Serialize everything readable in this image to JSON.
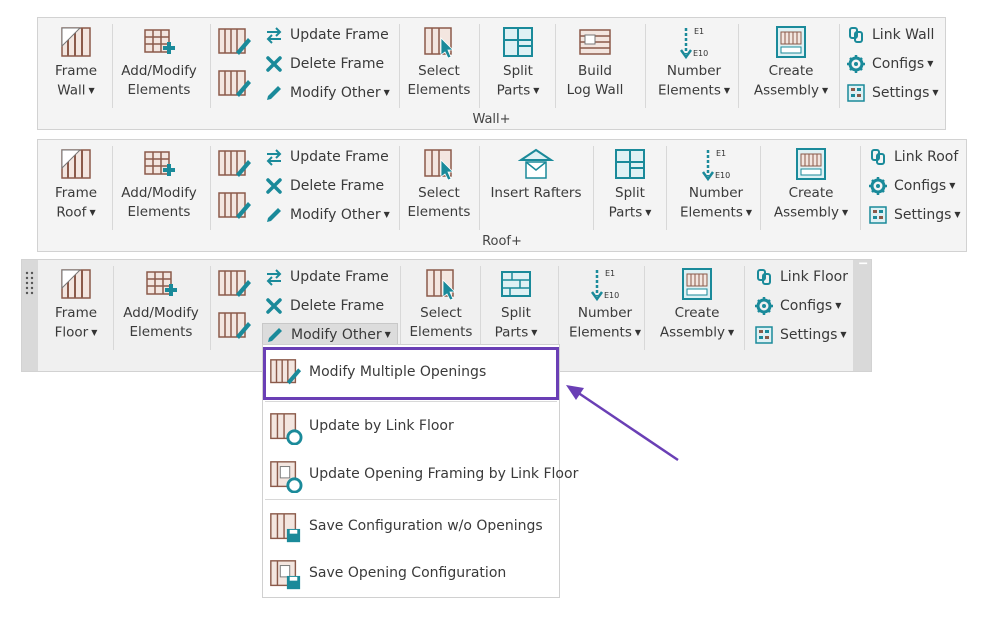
{
  "wall": {
    "title": "Wall+",
    "frame": "Frame\nWall",
    "add_modify": "Add/Modify\nElements",
    "update_frame": "Update Frame",
    "delete_frame": "Delete Frame",
    "modify_other": "Modify Other",
    "select": "Select\nElements",
    "split": "Split\nParts",
    "build_log": "Build\nLog Wall",
    "number": "Number\nElements",
    "create_assembly": "Create\nAssembly",
    "link": "Link Wall",
    "configs": "Configs",
    "settings": "Settings"
  },
  "roof": {
    "title": "Roof+",
    "frame": "Frame\nRoof",
    "add_modify": "Add/Modify\nElements",
    "update_frame": "Update Frame",
    "delete_frame": "Delete Frame",
    "modify_other": "Modify Other",
    "select": "Select\nElements",
    "insert_rafters": "Insert Rafters",
    "split": "Split\nParts",
    "number": "Number\nElements",
    "create_assembly": "Create\nAssembly",
    "link": "Link Roof",
    "configs": "Configs",
    "settings": "Settings"
  },
  "floor": {
    "frame": "Frame\nFloor",
    "add_modify": "Add/Modify\nElements",
    "update_frame": "Update Frame",
    "delete_frame": "Delete Frame",
    "modify_other": "Modify Other",
    "select": "Select\nElements",
    "split": "Split\nParts",
    "number": "Number\nElements",
    "create_assembly": "Create\nAssembly",
    "link": "Link Floor",
    "configs": "Configs",
    "settings": "Settings"
  },
  "menu": {
    "items": [
      "Modify Multiple Openings",
      "Update by Link Floor",
      "Update Opening Framing by Link Floor",
      "Save Configuration w/o Openings",
      "Save Opening Configuration"
    ]
  },
  "icons": {
    "teal": "#1a8a9a",
    "brown": "#8b5a4a",
    "highlight": "#6a3fb5"
  }
}
